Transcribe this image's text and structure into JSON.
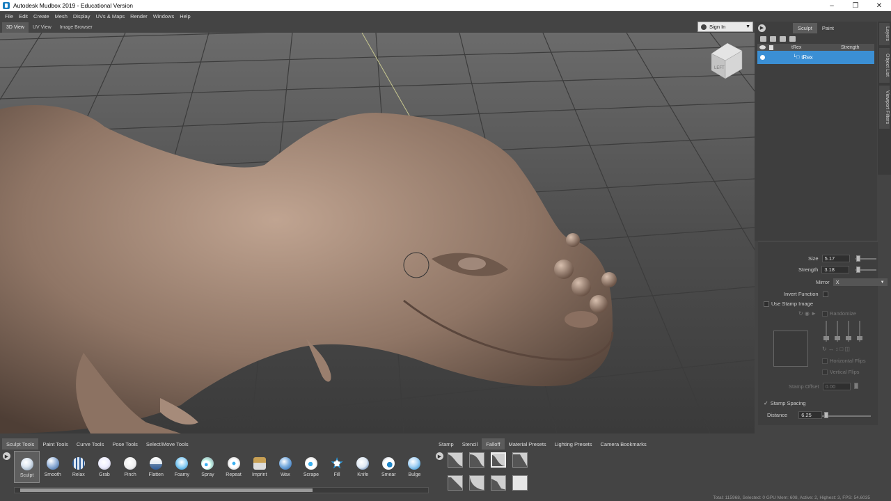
{
  "window": {
    "title": "Autodesk Mudbox 2019 - Educational Version"
  },
  "menu": [
    "File",
    "Edit",
    "Create",
    "Mesh",
    "Display",
    "UVs & Maps",
    "Render",
    "Windows",
    "Help"
  ],
  "view_tabs": [
    "3D View",
    "UV View",
    "Image Browser"
  ],
  "signin": {
    "label": "Sign In"
  },
  "viewcube": {
    "face_label": "LEFT"
  },
  "panel": {
    "mode_tabs": [
      "Sculpt",
      "Paint"
    ],
    "layers_header": {
      "name_col": "tRex",
      "strength_col": "Strength"
    },
    "layer_name": "tRex",
    "side_tabs": [
      "Layers",
      "Object List",
      "Viewport Filters"
    ]
  },
  "props": {
    "size_label": "Size",
    "size_value": "5.17",
    "strength_label": "Strength",
    "strength_value": "3.18",
    "mirror_label": "Mirror",
    "mirror_value": "X",
    "invert_label": "Invert Function",
    "use_stamp_label": "Use Stamp Image",
    "randomize_label": "Randomize",
    "hflip_label": "Horizontal Flips",
    "vflip_label": "Vertical Flips",
    "stamp_offset_label": "Stamp Offset",
    "stamp_offset_value": "0.00",
    "stamp_spacing_label": "Stamp Spacing",
    "distance_label": "Distance",
    "distance_value": "6.25"
  },
  "tool_tabs": [
    "Sculpt Tools",
    "Paint Tools",
    "Curve Tools",
    "Pose Tools",
    "Select/Move Tools"
  ],
  "tools": [
    "Sculpt",
    "Smooth",
    "Relax",
    "Grab",
    "Pinch",
    "Flatten",
    "Foamy",
    "Spray",
    "Repeat",
    "Imprint",
    "Wax",
    "Scrape",
    "Fill",
    "Knife",
    "Smear",
    "Bulge"
  ],
  "tray_tabs": [
    "Stamp",
    "Stencil",
    "Falloff",
    "Material Presets",
    "Lighting Presets",
    "Camera Bookmarks"
  ],
  "status": "Total: 115968, Selected: 0 GPU Mem: 608, Active: 2, Highest: 3, FPS: 54.6035"
}
